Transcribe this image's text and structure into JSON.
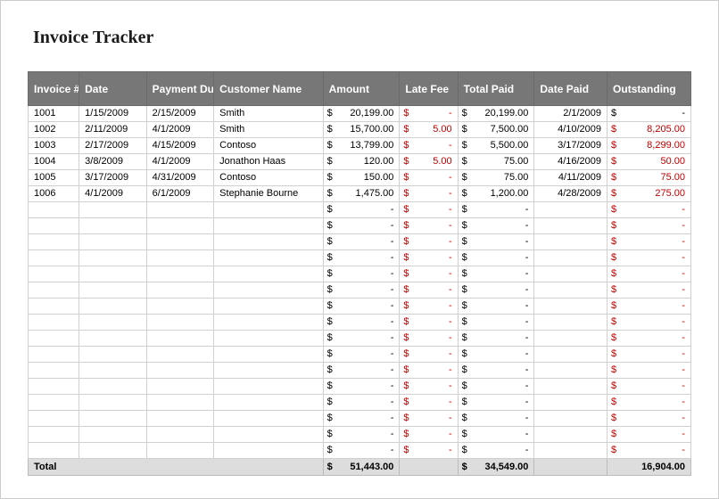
{
  "title": "Invoice Tracker",
  "headers": {
    "invoice": "Invoice #",
    "date": "Date",
    "due": "Payment Due",
    "customer": "Customer Name",
    "amount": "Amount",
    "latefee": "Late Fee",
    "totalpaid": "Total Paid",
    "datepaid": "Date Paid",
    "outstanding": "Outstanding"
  },
  "currency": "$",
  "dash": "-",
  "rows": [
    {
      "invoice": "1001",
      "date": "1/15/2009",
      "due": "2/15/2009",
      "customer": "Smith",
      "amount": "20,199.00",
      "latefee": "-",
      "totalpaid": "20,199.00",
      "datepaid": "2/1/2009",
      "outstanding": "-",
      "out_red": false
    },
    {
      "invoice": "1002",
      "date": "2/11/2009",
      "due": "4/1/2009",
      "customer": "Smith",
      "amount": "15,700.00",
      "latefee": "5.00",
      "totalpaid": "7,500.00",
      "datepaid": "4/10/2009",
      "outstanding": "8,205.00",
      "out_red": true
    },
    {
      "invoice": "1003",
      "date": "2/17/2009",
      "due": "4/15/2009",
      "customer": "Contoso",
      "amount": "13,799.00",
      "latefee": "-",
      "totalpaid": "5,500.00",
      "datepaid": "3/17/2009",
      "outstanding": "8,299.00",
      "out_red": true
    },
    {
      "invoice": "1004",
      "date": "3/8/2009",
      "due": "4/1/2009",
      "customer": "Jonathon Haas",
      "amount": "120.00",
      "latefee": "5.00",
      "totalpaid": "75.00",
      "datepaid": "4/16/2009",
      "outstanding": "50.00",
      "out_red": true
    },
    {
      "invoice": "1005",
      "date": "3/17/2009",
      "due": "4/31/2009",
      "customer": "Contoso",
      "amount": "150.00",
      "latefee": "-",
      "totalpaid": "75.00",
      "datepaid": "4/11/2009",
      "outstanding": "75.00",
      "out_red": true
    },
    {
      "invoice": "1006",
      "date": "4/1/2009",
      "due": "6/1/2009",
      "customer": "Stephanie Bourne",
      "amount": "1,475.00",
      "latefee": "-",
      "totalpaid": "1,200.00",
      "datepaid": "4/28/2009",
      "outstanding": "275.00",
      "out_red": true
    }
  ],
  "empty_rows": 16,
  "totals": {
    "label": "Total",
    "amount": "51,443.00",
    "totalpaid": "34,549.00",
    "outstanding": "16,904.00"
  }
}
